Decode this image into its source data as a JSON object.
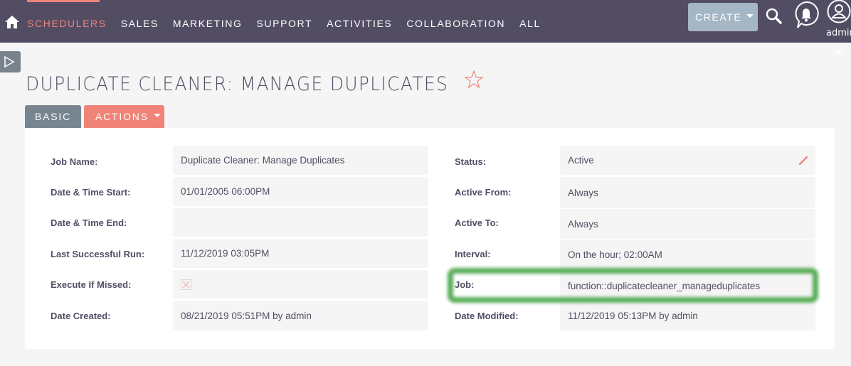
{
  "topnav": {
    "items": [
      {
        "label": "SCHEDULERS",
        "active": true
      },
      {
        "label": "SALES",
        "active": false
      },
      {
        "label": "MARKETING",
        "active": false
      },
      {
        "label": "SUPPORT",
        "active": false
      },
      {
        "label": "ACTIVITIES",
        "active": false
      },
      {
        "label": "COLLABORATION",
        "active": false
      },
      {
        "label": "ALL",
        "active": false
      }
    ],
    "create_label": "CREATE",
    "user_label": "admin",
    "icons": {
      "home": "home-icon",
      "search": "search-icon",
      "notifications": "bell-icon",
      "user": "user-icon"
    }
  },
  "page": {
    "title": "DUPLICATE CLEANER: MANAGE DUPLICATES",
    "favorite": false
  },
  "tabs": {
    "basic": "BASIC",
    "actions": "ACTIONS"
  },
  "fields": {
    "left": [
      {
        "label": "Job Name:",
        "value": "Duplicate Cleaner: Manage Duplicates"
      },
      {
        "label": "Date & Time Start:",
        "value": "01/01/2005 06:00PM"
      },
      {
        "label": "Date & Time End:",
        "value": ""
      },
      {
        "label": "Last Successful Run:",
        "value": "11/12/2019 03:05PM"
      },
      {
        "label": "Execute If Missed:",
        "value": "",
        "checkbox": false
      },
      {
        "label": "Date Created:",
        "value": "08/21/2019 05:51PM by admin"
      }
    ],
    "right": [
      {
        "label": "Status:",
        "value": "Active"
      },
      {
        "label": "Active From:",
        "value": "Always"
      },
      {
        "label": "Active To:",
        "value": "Always"
      },
      {
        "label": "Interval:",
        "value": "On the hour; 02:00AM"
      },
      {
        "label": "Job:",
        "value": "function::duplicatecleaner_manageduplicates"
      },
      {
        "label": "Date Modified:",
        "value": "11/12/2019 05:13PM by admin"
      }
    ]
  },
  "colors": {
    "topbar": "#534d64",
    "accent": "#f08377",
    "create_button": "#a5b6c4",
    "basic_tab": "#778591",
    "highlight": "#4aa64a"
  }
}
